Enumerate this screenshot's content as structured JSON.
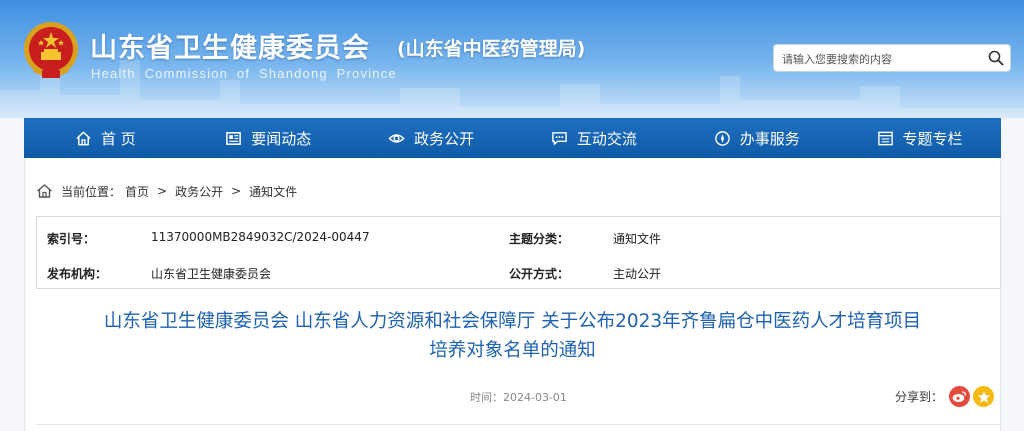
{
  "header": {
    "title": "山东省卫生健康委员会",
    "subtitle": "(山东省中医药管理局)",
    "title_en": "Health Commission of Shandong Province",
    "emblem": "national-emblem",
    "brand_color": "#1f6fc0"
  },
  "search": {
    "placeholder": "请输入您要搜索的内容",
    "icon": "search-icon"
  },
  "nav": {
    "items": [
      {
        "label": "首 页",
        "icon": "home-icon"
      },
      {
        "label": "要闻动态",
        "icon": "newspaper-icon"
      },
      {
        "label": "政务公开",
        "icon": "eye-icon"
      },
      {
        "label": "互动交流",
        "icon": "chat-icon"
      },
      {
        "label": "办事服务",
        "icon": "compass-icon"
      },
      {
        "label": "专题专栏",
        "icon": "window-icon"
      }
    ]
  },
  "breadcrumb": {
    "prefix": "当前位置：",
    "items": [
      "首页",
      "政务公开",
      "通知文件"
    ],
    "separator": ">"
  },
  "meta": {
    "index_label": "索引号：",
    "index_value": "11370000MB2849032C/2024-00447",
    "category_label": "主题分类：",
    "category_value": "通知文件",
    "publisher_label": "发布机构：",
    "publisher_value": "山东省卫生健康委员会",
    "open_label": "公开方式：",
    "open_value": "主动公开"
  },
  "document": {
    "title_line1": "山东省卫生健康委员会 山东省人力资源和社会保障厅 关于公布2023年齐鲁扁仓中医药人才培育项目",
    "title_line2": "培养对象名单的通知",
    "date": "时间：2024-03-01",
    "title_color": "#1e62b0"
  },
  "share": {
    "label": "分享到：",
    "icons": [
      "weibo-icon",
      "qzone-icon"
    ]
  }
}
